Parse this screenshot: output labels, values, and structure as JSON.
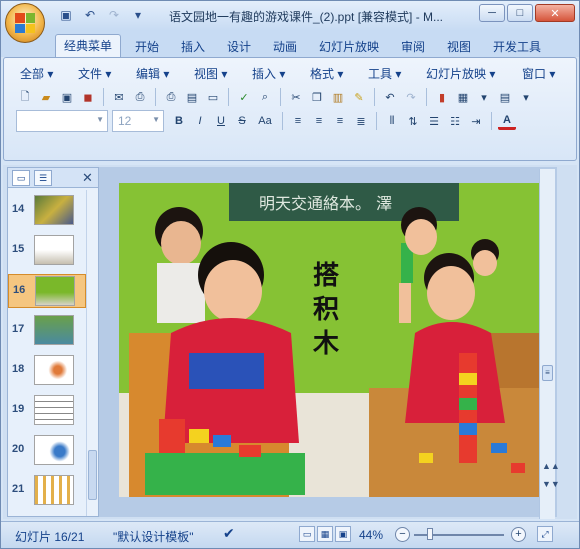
{
  "window": {
    "title": "语文园地一有趣的游戏课件_(2).ppt [兼容模式] - M..."
  },
  "qat_icons": [
    "save-icon",
    "undo-icon",
    "redo-icon",
    "customize-icon"
  ],
  "tabs": [
    "经典菜单",
    "开始",
    "插入",
    "设计",
    "动画",
    "幻灯片放映",
    "审阅",
    "视图",
    "开发工具"
  ],
  "classic_menu": [
    "全部",
    "文件",
    "编辑",
    "视图",
    "插入",
    "格式",
    "工具",
    "幻灯片放映",
    "窗口"
  ],
  "font_size": "12",
  "slides": [
    {
      "num": "14"
    },
    {
      "num": "15"
    },
    {
      "num": "16"
    },
    {
      "num": "17"
    },
    {
      "num": "18"
    },
    {
      "num": "19"
    },
    {
      "num": "20"
    },
    {
      "num": "21"
    }
  ],
  "selected_slide": "16",
  "slide": {
    "chars": [
      "搭",
      "积",
      "木"
    ],
    "chalkboard": "明天交通絡本。  澤"
  },
  "status": {
    "slide_info": "幻灯片 16/21",
    "template": "\"默认设计模板\"",
    "zoom": "44%"
  },
  "colors": {
    "accent": "#15428b",
    "ribbon": "#d8e6f7",
    "selected": "#f5c680"
  }
}
